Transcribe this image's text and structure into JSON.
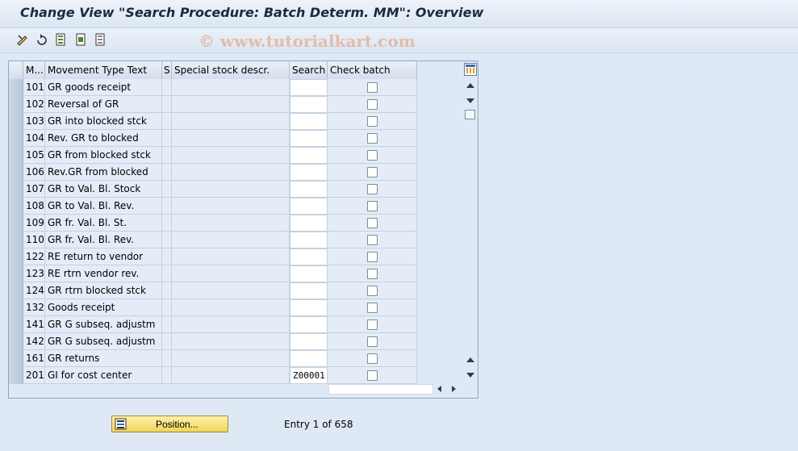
{
  "window": {
    "title": "Change View \"Search Procedure: Batch Determ. MM\": Overview"
  },
  "watermark": "© www.tutorialkart.com",
  "toolbar": {
    "icons": [
      "edit-toggle-icon",
      "refresh-icon",
      "select-all-icon",
      "select-block-icon",
      "deselect-icon"
    ]
  },
  "table": {
    "headers": {
      "mvt": "M...",
      "text": "Movement Type Text",
      "s": "S",
      "special": "Special stock descr.",
      "search": "Search",
      "check": "Check batch"
    },
    "rows": [
      {
        "mvt": "101",
        "text": "GR goods receipt",
        "search": "",
        "checked": false
      },
      {
        "mvt": "102",
        "text": "Reversal of GR",
        "search": "",
        "checked": false
      },
      {
        "mvt": "103",
        "text": "GR into blocked stck",
        "search": "",
        "checked": false
      },
      {
        "mvt": "104",
        "text": "Rev. GR to blocked",
        "search": "",
        "checked": false
      },
      {
        "mvt": "105",
        "text": "GR from blocked stck",
        "search": "",
        "checked": false
      },
      {
        "mvt": "106",
        "text": "Rev.GR from blocked",
        "search": "",
        "checked": false
      },
      {
        "mvt": "107",
        "text": "GR to Val. Bl. Stock",
        "search": "",
        "checked": false
      },
      {
        "mvt": "108",
        "text": "GR to Val. Bl. Rev.",
        "search": "",
        "checked": false
      },
      {
        "mvt": "109",
        "text": "GR fr. Val. Bl. St.",
        "search": "",
        "checked": false
      },
      {
        "mvt": "110",
        "text": "GR fr. Val. Bl. Rev.",
        "search": "",
        "checked": false
      },
      {
        "mvt": "122",
        "text": "RE return to vendor",
        "search": "",
        "checked": false
      },
      {
        "mvt": "123",
        "text": "RE rtrn vendor rev.",
        "search": "",
        "checked": false
      },
      {
        "mvt": "124",
        "text": "GR rtrn blocked stck",
        "search": "",
        "checked": false
      },
      {
        "mvt": "132",
        "text": "Goods receipt",
        "search": "",
        "checked": false
      },
      {
        "mvt": "141",
        "text": "GR G subseq. adjustm",
        "search": "",
        "checked": false
      },
      {
        "mvt": "142",
        "text": "GR G subseq. adjustm",
        "search": "",
        "checked": false
      },
      {
        "mvt": "161",
        "text": "GR returns",
        "search": "",
        "checked": false
      },
      {
        "mvt": "201",
        "text": "GI for cost center",
        "search": "Z00001",
        "checked": false
      }
    ]
  },
  "footer": {
    "position_button": "Position...",
    "entry_text": "Entry 1 of 658"
  }
}
